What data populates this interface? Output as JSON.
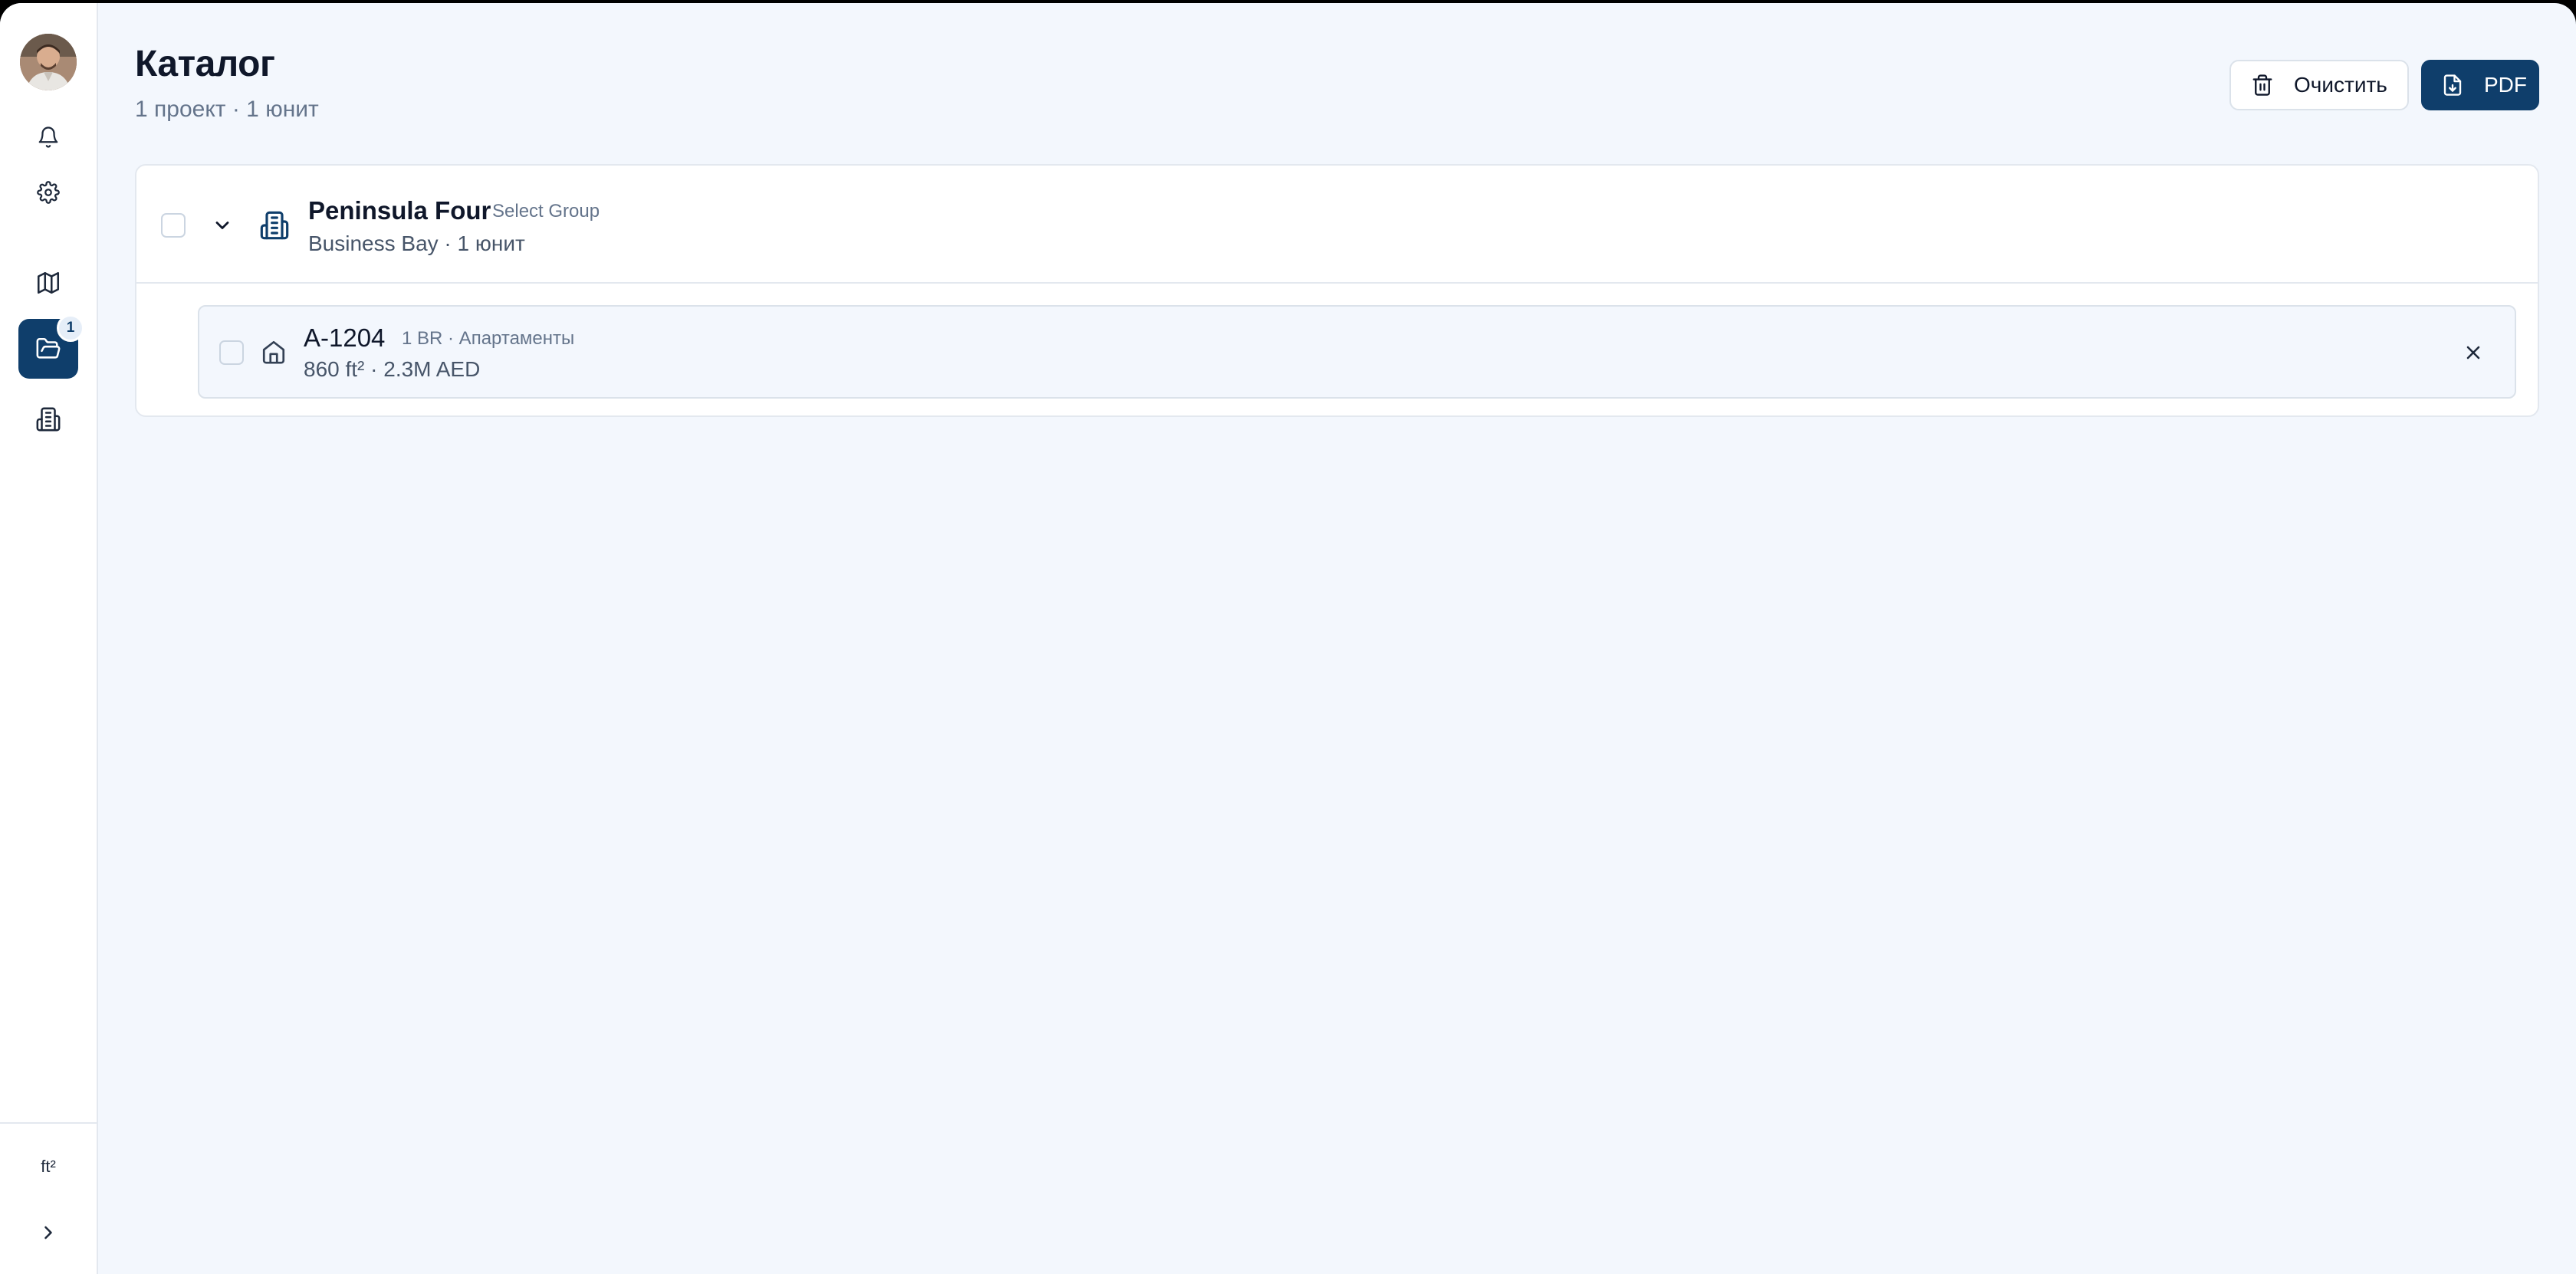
{
  "sidebar": {
    "avatar_alt": "",
    "items": [
      {
        "id": "notifications",
        "icon": "bell-icon"
      },
      {
        "id": "settings",
        "icon": "gear-icon"
      },
      {
        "id": "map",
        "icon": "map-icon"
      },
      {
        "id": "catalog",
        "icon": "folder-open-icon",
        "active": true,
        "badge": "1"
      },
      {
        "id": "buildings",
        "icon": "building-icon"
      }
    ],
    "units_label": "ft²",
    "expand_icon": "chevron-right-icon"
  },
  "header": {
    "title": "Каталог",
    "subtitle": "1 проект · 1 юнит"
  },
  "toolbar": {
    "clear_label": "Очистить",
    "clear_icon": "trash-icon",
    "pdf_label": "PDF",
    "pdf_icon": "file-download-icon"
  },
  "catalog": {
    "groups": [
      {
        "name": "Peninsula Four",
        "tag": "Select Group",
        "meta": "Business Bay · 1 юнит",
        "expanded": true,
        "units": [
          {
            "name": "A-1204",
            "tag": "1 BR · Апартаменты",
            "meta": "860 ft² · 2.3M AED"
          }
        ]
      }
    ]
  },
  "colors": {
    "accent": "#0f3e6b",
    "background": "#f3f7fd",
    "muted_text": "#64748b",
    "border": "#e3e8ef"
  }
}
